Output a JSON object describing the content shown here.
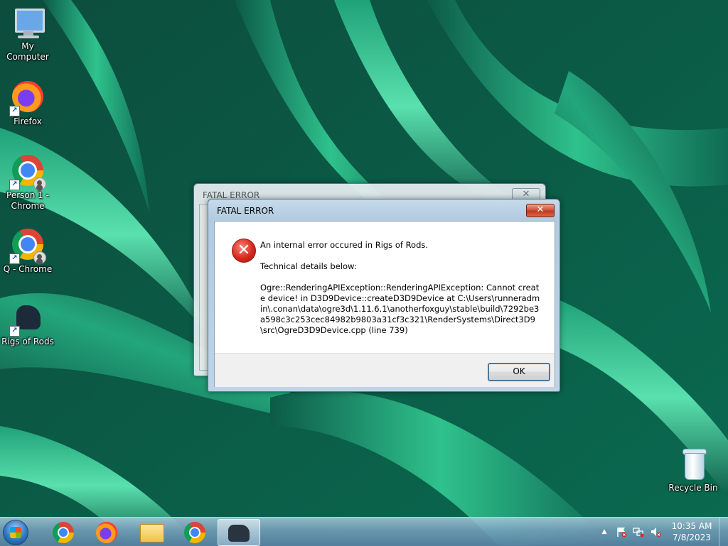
{
  "desktop": {
    "icons": [
      {
        "label": "My Computer"
      },
      {
        "label": "Firefox"
      },
      {
        "label": "Person 1 - Chrome"
      },
      {
        "label": "Q - Chrome"
      },
      {
        "label": "Rigs of Rods"
      },
      {
        "label": "Recycle Bin"
      }
    ]
  },
  "background_window": {
    "title": "FATAL ERROR",
    "close_glyph": "✕"
  },
  "dialog": {
    "title": "FATAL ERROR",
    "close_glyph": "✕",
    "icon": "error-icon",
    "message": "An internal error occured in Rigs of Rods.",
    "details_heading": "Technical details below:",
    "details": "Ogre::RenderingAPIException::RenderingAPIException: Cannot create device! in D3D9Device::createD3D9Device at C:\\Users\\runneradmin\\.conan\\data\\ogre3d\\1.11.6.1\\anotherfoxguy\\stable\\build\\7292be3a598c3c253cec84982b9803a31cf3c321\\RenderSystems\\Direct3D9\\src\\OgreD3D9Device.cpp (line 739)",
    "ok_label": "OK"
  },
  "taskbar": {
    "buttons": [
      {
        "icon": "chrome-icon"
      },
      {
        "icon": "firefox-icon"
      },
      {
        "icon": "file-explorer-icon"
      },
      {
        "icon": "chrome-icon"
      },
      {
        "icon": "rigs-of-rods-icon",
        "active": true
      }
    ],
    "tray": {
      "show_hidden_glyph": "▲",
      "time": "10:35 AM",
      "date": "7/8/2023"
    }
  },
  "colors": {
    "wallpaper_dark": "#0a4a3c",
    "wallpaper_light": "#3ad39a",
    "close_red": "#c7402a",
    "error_red": "#d62a1e"
  }
}
